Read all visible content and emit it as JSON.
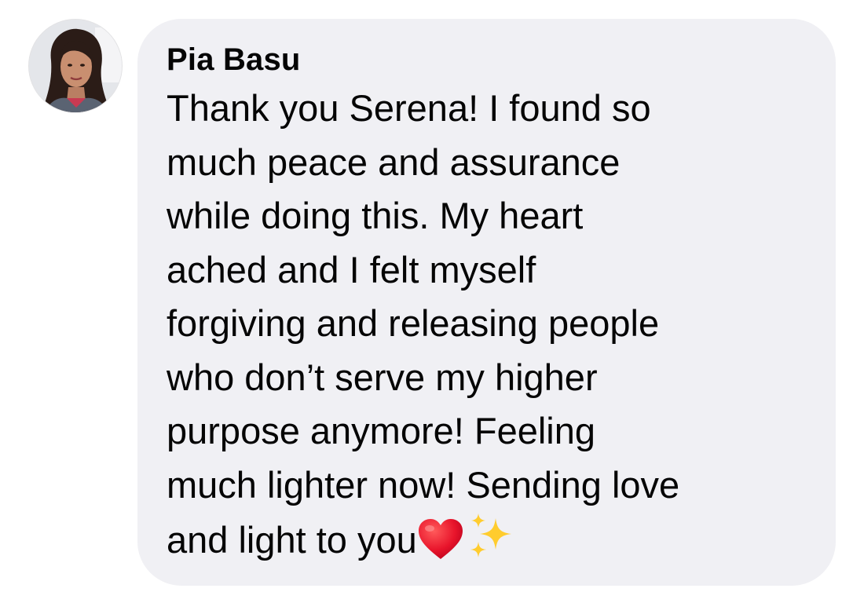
{
  "comment": {
    "author": "Pia Basu",
    "text": "Thank you Serena! I found so\nmuch peace and assurance\nwhile doing this. My heart\nached and I felt myself\nforgiving and releasing people\nwho don’t serve my higher\npurpose anymore! Feeling\nmuch lighter now! Sending love\nand light to you",
    "emojis": [
      "red-heart",
      "sparkles"
    ],
    "bubble_color": "#f0f0f4",
    "text_color": "#050505"
  }
}
